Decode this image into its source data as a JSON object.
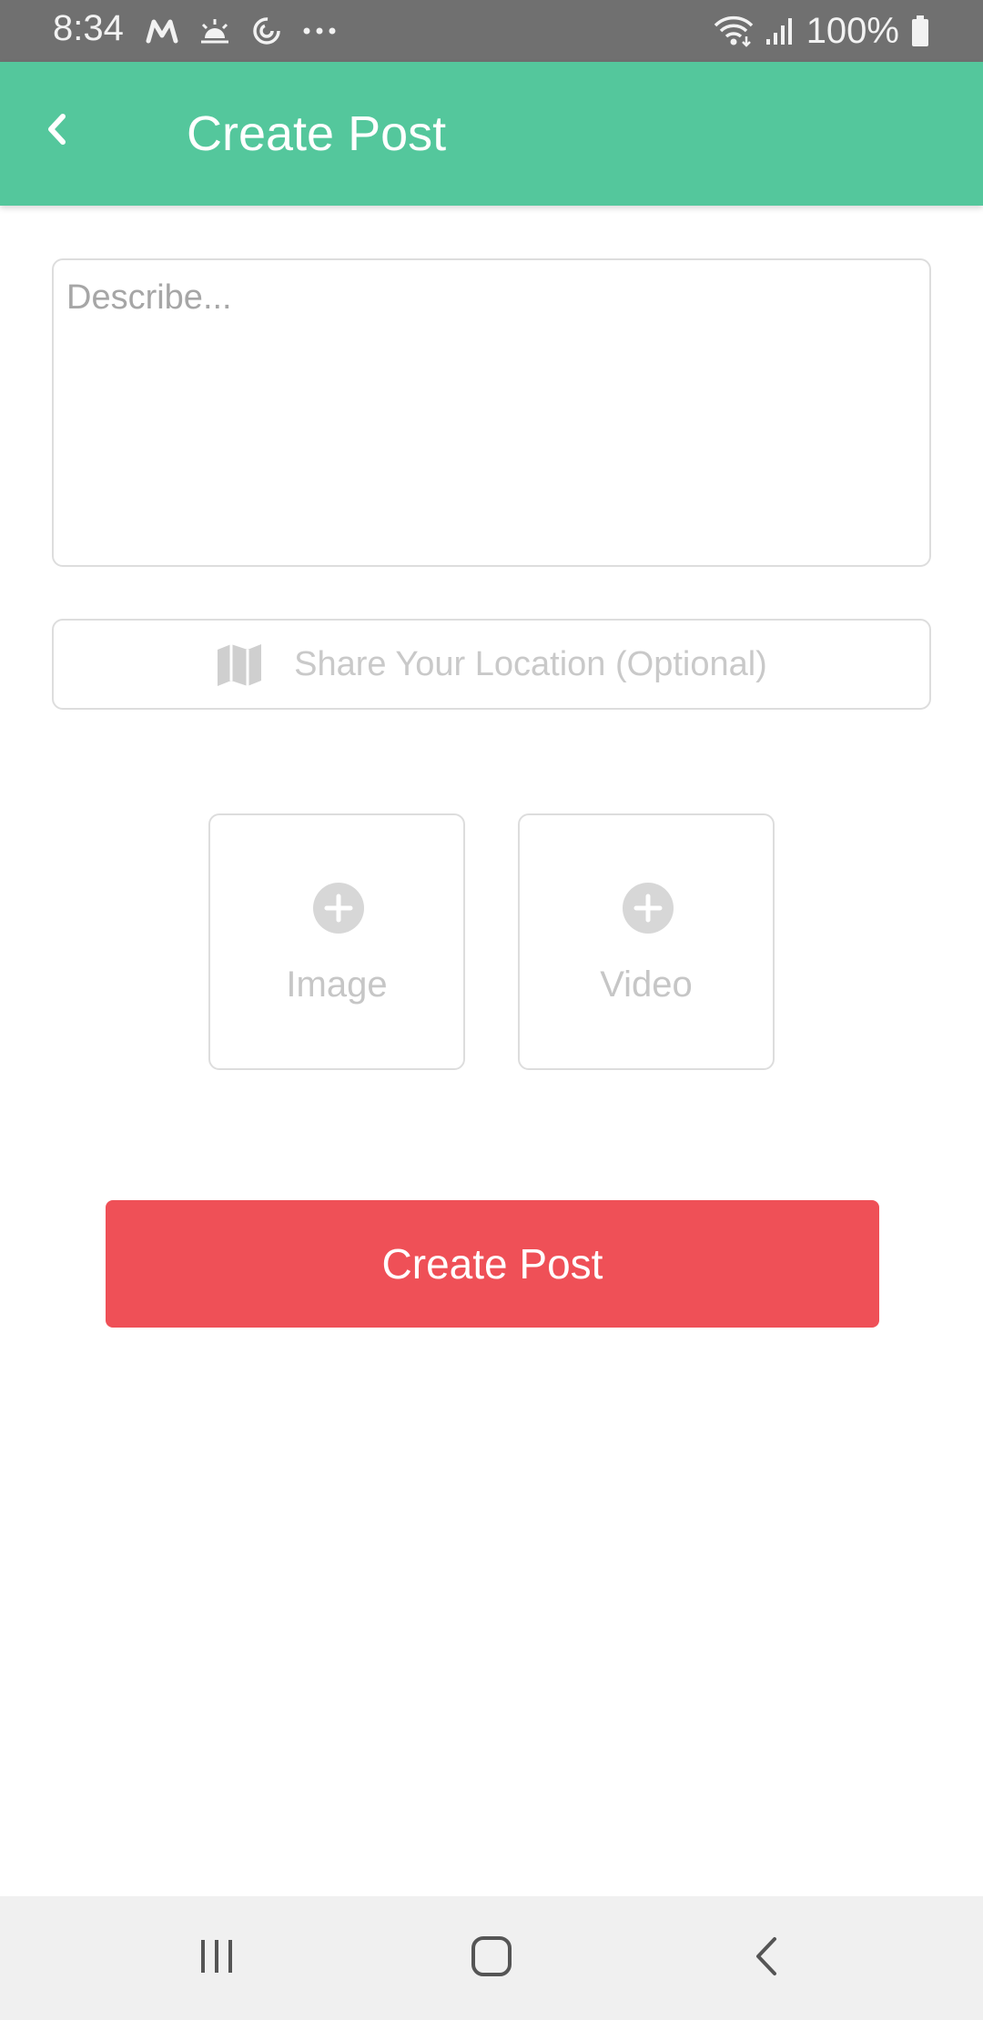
{
  "status_bar": {
    "time": "8:34",
    "battery": "100%",
    "left_icons": [
      "m-notification-icon",
      "weather-sun-icon",
      "sync-icon",
      "more-dots-icon"
    ],
    "right_icons": [
      "wifi-icon",
      "signal-icon",
      "battery-icon"
    ]
  },
  "app_bar": {
    "title": "Create Post",
    "back_icon": "chevron-left-icon",
    "color": "#54c79c"
  },
  "form": {
    "describe_placeholder": "Describe...",
    "describe_value": "",
    "location_label": "Share Your Location (Optional)",
    "location_icon": "map-icon",
    "media": [
      {
        "label": "Image",
        "icon": "plus-circle-icon"
      },
      {
        "label": "Video",
        "icon": "plus-circle-icon"
      }
    ],
    "submit_label": "Create Post",
    "submit_color": "#ef5057"
  },
  "nav_bar": {
    "buttons": [
      "recents-icon",
      "home-icon",
      "back-icon"
    ]
  }
}
